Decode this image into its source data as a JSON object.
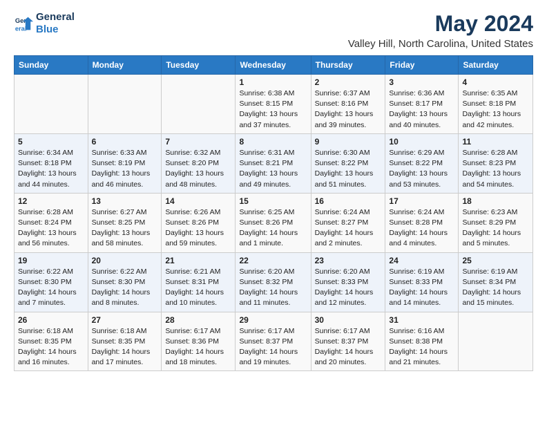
{
  "logo": {
    "line1": "General",
    "line2": "Blue"
  },
  "title": "May 2024",
  "subtitle": "Valley Hill, North Carolina, United States",
  "headers": [
    "Sunday",
    "Monday",
    "Tuesday",
    "Wednesday",
    "Thursday",
    "Friday",
    "Saturday"
  ],
  "weeks": [
    [
      {
        "day": "",
        "info": ""
      },
      {
        "day": "",
        "info": ""
      },
      {
        "day": "",
        "info": ""
      },
      {
        "day": "1",
        "info": "Sunrise: 6:38 AM\nSunset: 8:15 PM\nDaylight: 13 hours\nand 37 minutes."
      },
      {
        "day": "2",
        "info": "Sunrise: 6:37 AM\nSunset: 8:16 PM\nDaylight: 13 hours\nand 39 minutes."
      },
      {
        "day": "3",
        "info": "Sunrise: 6:36 AM\nSunset: 8:17 PM\nDaylight: 13 hours\nand 40 minutes."
      },
      {
        "day": "4",
        "info": "Sunrise: 6:35 AM\nSunset: 8:18 PM\nDaylight: 13 hours\nand 42 minutes."
      }
    ],
    [
      {
        "day": "5",
        "info": "Sunrise: 6:34 AM\nSunset: 8:18 PM\nDaylight: 13 hours\nand 44 minutes."
      },
      {
        "day": "6",
        "info": "Sunrise: 6:33 AM\nSunset: 8:19 PM\nDaylight: 13 hours\nand 46 minutes."
      },
      {
        "day": "7",
        "info": "Sunrise: 6:32 AM\nSunset: 8:20 PM\nDaylight: 13 hours\nand 48 minutes."
      },
      {
        "day": "8",
        "info": "Sunrise: 6:31 AM\nSunset: 8:21 PM\nDaylight: 13 hours\nand 49 minutes."
      },
      {
        "day": "9",
        "info": "Sunrise: 6:30 AM\nSunset: 8:22 PM\nDaylight: 13 hours\nand 51 minutes."
      },
      {
        "day": "10",
        "info": "Sunrise: 6:29 AM\nSunset: 8:22 PM\nDaylight: 13 hours\nand 53 minutes."
      },
      {
        "day": "11",
        "info": "Sunrise: 6:28 AM\nSunset: 8:23 PM\nDaylight: 13 hours\nand 54 minutes."
      }
    ],
    [
      {
        "day": "12",
        "info": "Sunrise: 6:28 AM\nSunset: 8:24 PM\nDaylight: 13 hours\nand 56 minutes."
      },
      {
        "day": "13",
        "info": "Sunrise: 6:27 AM\nSunset: 8:25 PM\nDaylight: 13 hours\nand 58 minutes."
      },
      {
        "day": "14",
        "info": "Sunrise: 6:26 AM\nSunset: 8:26 PM\nDaylight: 13 hours\nand 59 minutes."
      },
      {
        "day": "15",
        "info": "Sunrise: 6:25 AM\nSunset: 8:26 PM\nDaylight: 14 hours\nand 1 minute."
      },
      {
        "day": "16",
        "info": "Sunrise: 6:24 AM\nSunset: 8:27 PM\nDaylight: 14 hours\nand 2 minutes."
      },
      {
        "day": "17",
        "info": "Sunrise: 6:24 AM\nSunset: 8:28 PM\nDaylight: 14 hours\nand 4 minutes."
      },
      {
        "day": "18",
        "info": "Sunrise: 6:23 AM\nSunset: 8:29 PM\nDaylight: 14 hours\nand 5 minutes."
      }
    ],
    [
      {
        "day": "19",
        "info": "Sunrise: 6:22 AM\nSunset: 8:30 PM\nDaylight: 14 hours\nand 7 minutes."
      },
      {
        "day": "20",
        "info": "Sunrise: 6:22 AM\nSunset: 8:30 PM\nDaylight: 14 hours\nand 8 minutes."
      },
      {
        "day": "21",
        "info": "Sunrise: 6:21 AM\nSunset: 8:31 PM\nDaylight: 14 hours\nand 10 minutes."
      },
      {
        "day": "22",
        "info": "Sunrise: 6:20 AM\nSunset: 8:32 PM\nDaylight: 14 hours\nand 11 minutes."
      },
      {
        "day": "23",
        "info": "Sunrise: 6:20 AM\nSunset: 8:33 PM\nDaylight: 14 hours\nand 12 minutes."
      },
      {
        "day": "24",
        "info": "Sunrise: 6:19 AM\nSunset: 8:33 PM\nDaylight: 14 hours\nand 14 minutes."
      },
      {
        "day": "25",
        "info": "Sunrise: 6:19 AM\nSunset: 8:34 PM\nDaylight: 14 hours\nand 15 minutes."
      }
    ],
    [
      {
        "day": "26",
        "info": "Sunrise: 6:18 AM\nSunset: 8:35 PM\nDaylight: 14 hours\nand 16 minutes."
      },
      {
        "day": "27",
        "info": "Sunrise: 6:18 AM\nSunset: 8:35 PM\nDaylight: 14 hours\nand 17 minutes."
      },
      {
        "day": "28",
        "info": "Sunrise: 6:17 AM\nSunset: 8:36 PM\nDaylight: 14 hours\nand 18 minutes."
      },
      {
        "day": "29",
        "info": "Sunrise: 6:17 AM\nSunset: 8:37 PM\nDaylight: 14 hours\nand 19 minutes."
      },
      {
        "day": "30",
        "info": "Sunrise: 6:17 AM\nSunset: 8:37 PM\nDaylight: 14 hours\nand 20 minutes."
      },
      {
        "day": "31",
        "info": "Sunrise: 6:16 AM\nSunset: 8:38 PM\nDaylight: 14 hours\nand 21 minutes."
      },
      {
        "day": "",
        "info": ""
      }
    ]
  ]
}
